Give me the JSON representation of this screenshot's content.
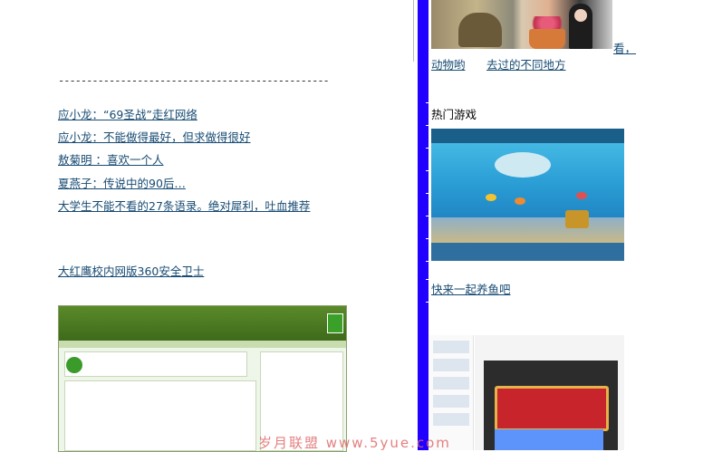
{
  "left": {
    "separator": "------------------------------------------------",
    "links": [
      "应小龙：“69圣战”走红网络",
      "应小龙：不能做得最好，但求做得很好",
      "敖菊明 ：喜欢一个人",
      "夏燕子：传说中的90后…",
      "大学生不能不看的27条语录。绝对犀利，吐血推荐"
    ],
    "software_link": "大红鹰校内网版360安全卫士"
  },
  "right": {
    "photo_caption_tail": "看，",
    "photo_caption_line2_a": "动物哟",
    "photo_caption_line2_b": "去过的不同地方",
    "hot_games_title": "热门游戏",
    "game_link": "快来一起养鱼吧"
  },
  "watermark": "岁月联盟 www.5yue.com",
  "colors": {
    "link": "#174b73",
    "divider": "#2200ff",
    "watermark": "#e06a6a"
  }
}
